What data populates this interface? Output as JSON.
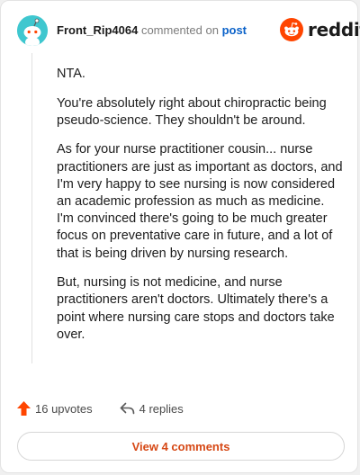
{
  "comment": {
    "username": "Front_Rip4064",
    "action_text": "commented on",
    "post_link": "post",
    "paragraphs": [
      "NTA.",
      "You're absolutely right about chiropractic being pseudo-science. They shouldn't be around.",
      "As for your nurse practitioner cousin... nurse practitioners are just as important as doctors, and I'm very happy to see nursing is now considered an academic profession as much as medicine. I'm convinced there's going to be much greater focus on preventative care in future, and a lot of that is being driven by nursing research.",
      "But, nursing is not medicine, and nurse practitioners aren't doctors. Ultimately there's a point where nursing care stops and doctors take over."
    ],
    "upvotes": "16 upvotes",
    "replies": "4 replies",
    "view_comments": "View 4 comments"
  },
  "brand": {
    "wordmark": "reddit",
    "icon": "reddit-snoo-icon",
    "color": "#ff4500"
  },
  "icons": {
    "avatar": "snoo-avatar-icon",
    "upvote": "upvote-arrow-icon",
    "reply": "reply-arrow-icon"
  },
  "colors": {
    "username": "#1c1c1c",
    "post_link": "#0b62c9",
    "upvote_arrow": "#ff4500",
    "view_button_text": "#d64815",
    "avatar_bg": "#3fc7cf"
  }
}
